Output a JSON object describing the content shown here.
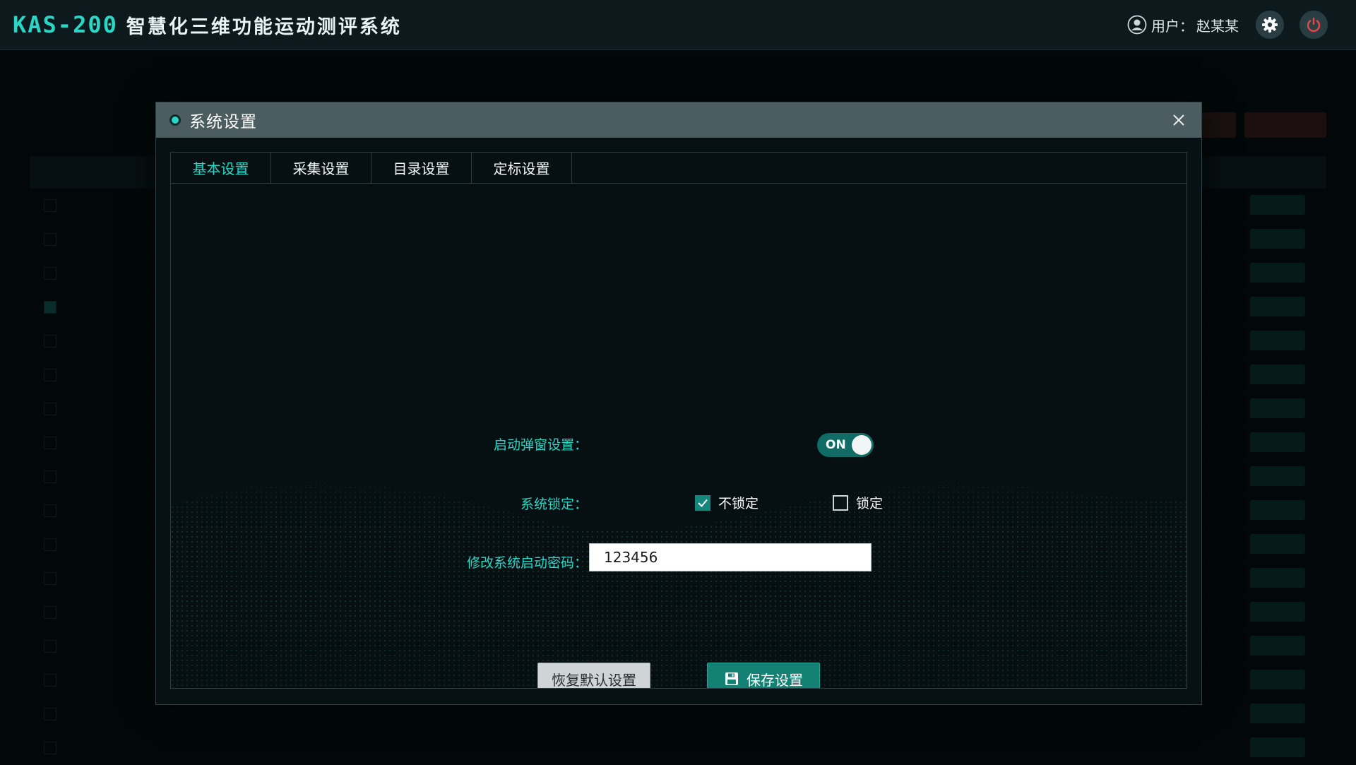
{
  "app": {
    "code": "KAS-200",
    "name": "智慧化三维功能运动测评系统"
  },
  "user": {
    "prefix": "用户：",
    "name": "赵某某"
  },
  "dialog": {
    "title": "系统设置",
    "tabs": [
      {
        "label": "基本设置",
        "active": true
      },
      {
        "label": "采集设置",
        "active": false
      },
      {
        "label": "目录设置",
        "active": false
      },
      {
        "label": "定标设置",
        "active": false
      }
    ],
    "settings": {
      "startup_popup": {
        "label": "启动弹窗设置：",
        "toggle_text": "ON",
        "enabled": true
      },
      "system_lock": {
        "label": "系统锁定：",
        "options": [
          {
            "label": "不锁定",
            "checked": true
          },
          {
            "label": "锁定",
            "checked": false
          }
        ]
      },
      "startup_password": {
        "label": "修改系统启动密码：",
        "value": "123456"
      }
    },
    "buttons": {
      "reset": "恢复默认设置",
      "save": "保存设置"
    }
  },
  "colors": {
    "accent": "#2ad6c6",
    "primary_button": "#138173",
    "header_bg": "#4c5d62"
  },
  "icons": {
    "user": "user-circle-icon",
    "settings": "gear-icon",
    "power": "power-icon",
    "close": "close-icon",
    "save": "save-disk-icon",
    "check": "checkmark-icon"
  }
}
